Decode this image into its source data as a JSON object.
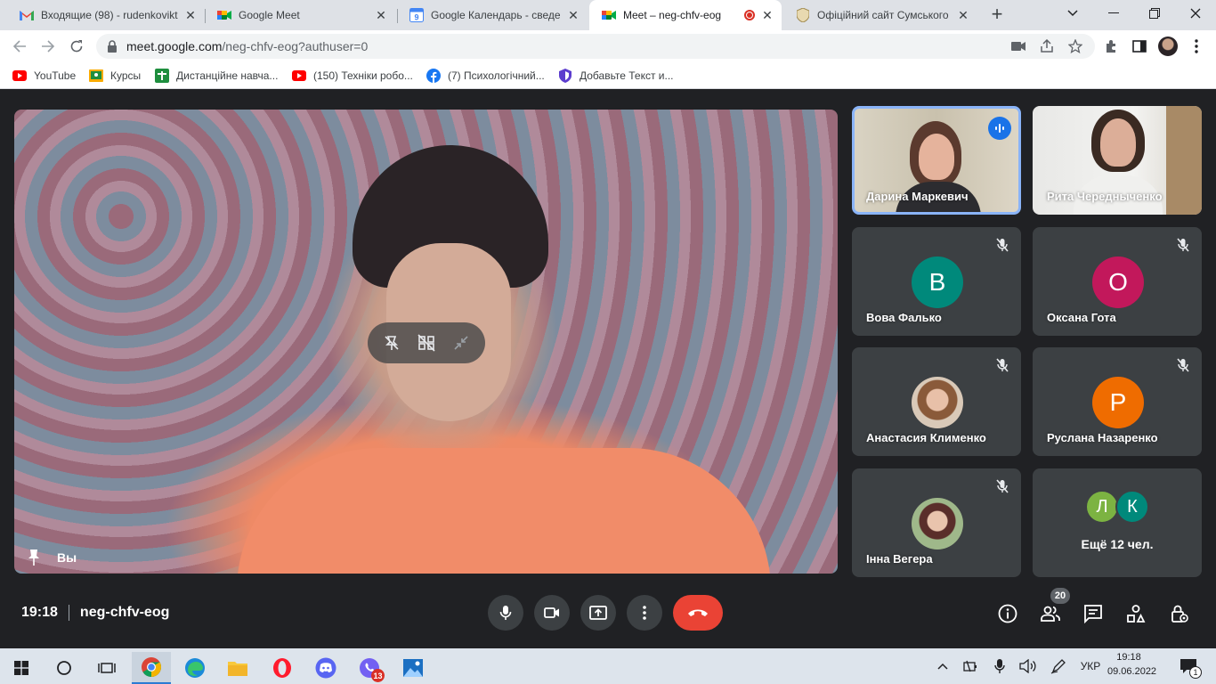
{
  "browser": {
    "tabs": [
      {
        "title": "Входящие (98) - rudenkovikt",
        "icon": "gmail-icon",
        "active": false
      },
      {
        "title": "Google Meet",
        "icon": "meet-icon",
        "active": false
      },
      {
        "title": "Google Календарь - сведени",
        "icon": "calendar-icon",
        "active": false
      },
      {
        "title": "Meet – neg-chfv-eog",
        "icon": "meet-icon",
        "active": true,
        "recording": true
      },
      {
        "title": "Офіційний сайт Сумського",
        "icon": "site-icon",
        "active": false
      }
    ],
    "url_host": "meet.google.com",
    "url_path": "/neg-chfv-eog?authuser=0",
    "bookmarks": [
      {
        "label": "YouTube",
        "icon": "youtube-icon"
      },
      {
        "label": "Курсы",
        "icon": "classroom-icon"
      },
      {
        "label": "Дистанційне навча...",
        "icon": "plus-icon"
      },
      {
        "label": "(150) Техніки робо...",
        "icon": "youtube-icon"
      },
      {
        "label": "(7) Психологічний...",
        "icon": "facebook-icon"
      },
      {
        "label": "Добавьте Текст и...",
        "icon": "shield-icon"
      }
    ]
  },
  "meet": {
    "self_label": "Вы",
    "time": "19:18",
    "meeting_code": "neg-chfv-eog",
    "participants_count": "20",
    "participants": [
      {
        "name": "Дарина Маркевич",
        "type": "video",
        "speaking": true
      },
      {
        "name": "Рита Чередныченко",
        "type": "video"
      },
      {
        "name": "Вова Фалько",
        "type": "letter",
        "letter": "В",
        "color": "#00897b",
        "muted": true
      },
      {
        "name": "Оксана Гота",
        "type": "letter",
        "letter": "О",
        "color": "#c2185b",
        "muted": true
      },
      {
        "name": "Анастасия Клименко",
        "type": "photo",
        "muted": true
      },
      {
        "name": "Руслана Назаренко",
        "type": "letter",
        "letter": "Р",
        "color": "#ef6c00",
        "muted": true
      },
      {
        "name": "Інна Вегера",
        "type": "photo",
        "muted": true
      }
    ],
    "more": {
      "avatars": [
        {
          "letter": "Л",
          "color": "#7cb342"
        },
        {
          "letter": "К",
          "color": "#00897b"
        }
      ],
      "label": "Ещё 12 чел."
    }
  },
  "taskbar": {
    "lang": "УКР",
    "time": "19:18",
    "date": "09.06.2022",
    "viber_badge": "13",
    "notifications": "1"
  }
}
